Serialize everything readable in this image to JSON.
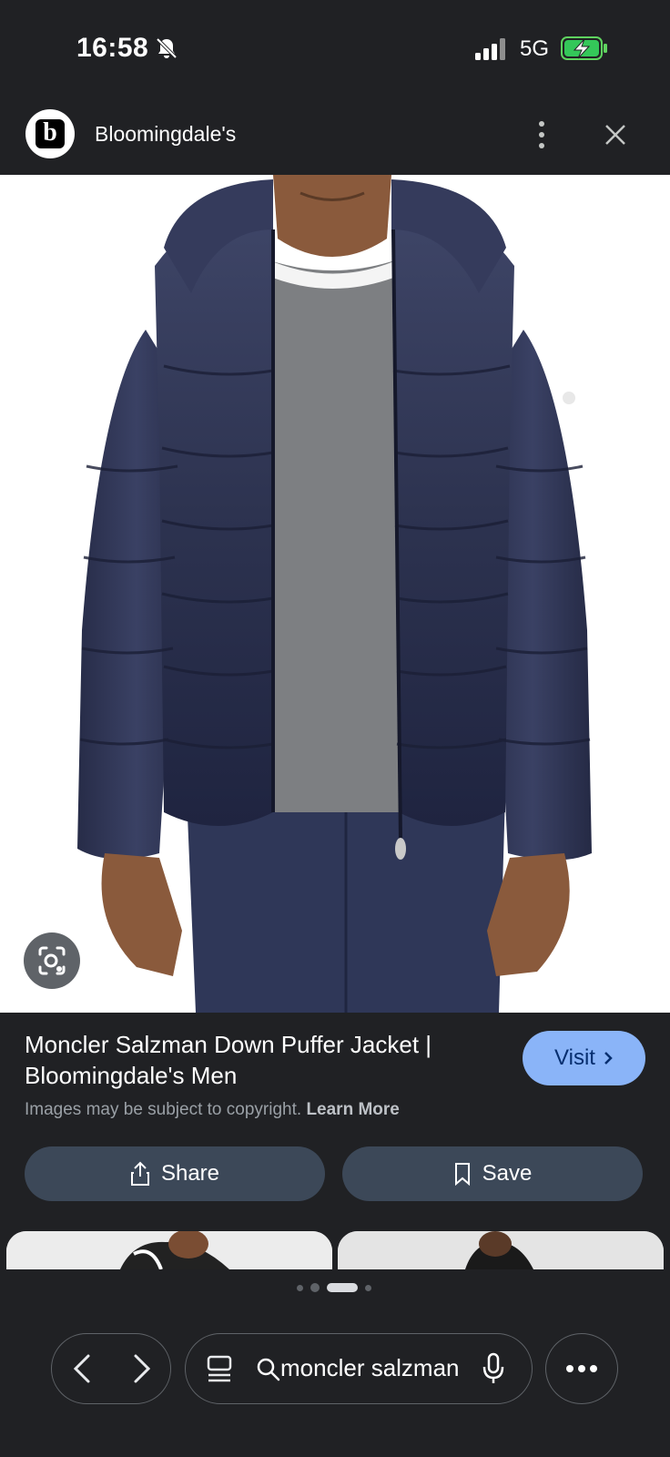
{
  "status_bar": {
    "time": "16:58",
    "network": "5G",
    "icons": [
      "bell-off-icon",
      "signal-icon",
      "battery-charging-icon"
    ]
  },
  "header": {
    "site_name": "Bloomingdale's",
    "logo_letter": "b"
  },
  "result": {
    "title": "Moncler Salzman Down Puffer Jacket | Bloomingdale's Men",
    "copyright_text": "Images may be subject to copyright.",
    "learn_more": "Learn More",
    "visit_label": "Visit",
    "share_label": "Share",
    "save_label": "Save"
  },
  "carousel": {
    "page_count": 4,
    "active_index": 2
  },
  "toolbar": {
    "search_query": "moncler salzman"
  },
  "colors": {
    "background": "#202124",
    "visit_button": "#8ab4f8",
    "action_pill": "#3c4858",
    "jacket_navy": "#2d3350"
  }
}
